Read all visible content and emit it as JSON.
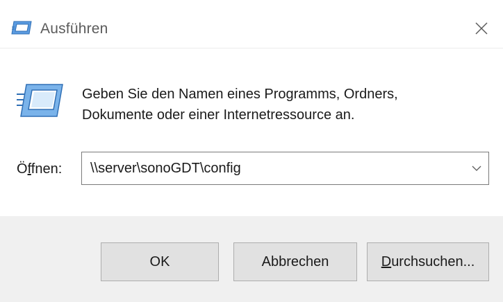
{
  "window": {
    "title": "Ausführen",
    "title_icon": "run-icon",
    "close_icon": "close-icon"
  },
  "body": {
    "big_icon": "run-icon",
    "description_line1": "Geben Sie den Namen eines Programms, Ordners,",
    "description_line2": "Dokumente oder einer Internetressource an."
  },
  "open": {
    "label_prefix": "Ö",
    "label_mnemonic": "f",
    "label_suffix": "fnen:",
    "value": "\\\\server\\sonoGDT\\config",
    "dropdown_icon": "chevron-down-icon"
  },
  "buttons": {
    "ok": "OK",
    "cancel": "Abbrechen",
    "browse_mnemonic": "D",
    "browse_rest": "urchsuchen..."
  },
  "colors": {
    "footer_bg": "#f0f0f0",
    "button_bg": "#e1e1e1",
    "button_border": "#adadad",
    "icon_blue": "#4a8fd6"
  }
}
